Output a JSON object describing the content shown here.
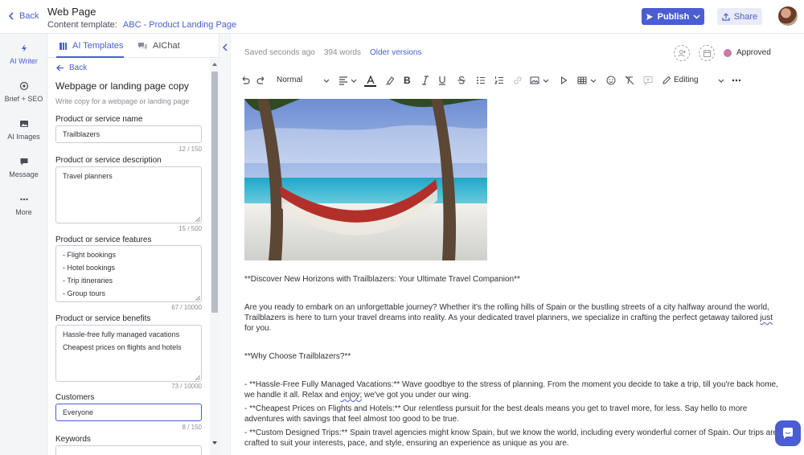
{
  "header": {
    "back_label": "Back",
    "title": "Web Page",
    "template_label": "Content template:",
    "template_link": "ABC - Product Landing Page",
    "publish_label": "Publish",
    "share_label": "Share"
  },
  "rail": {
    "items": [
      {
        "label": "AI Writer",
        "icon": "lightning-icon"
      },
      {
        "label": "Brief + SEO",
        "icon": "target-icon"
      },
      {
        "label": "AI Images",
        "icon": "image-icon"
      },
      {
        "label": "Message",
        "icon": "message-icon"
      },
      {
        "label": "More",
        "icon": "more-dots-icon"
      }
    ]
  },
  "panel": {
    "tabs": [
      {
        "label": "AI Templates",
        "icon": "templates-icon"
      },
      {
        "label": "AIChat",
        "icon": "chat-bubbles-icon"
      }
    ],
    "back_label": "Back",
    "section_title": "Webpage or landing page copy",
    "section_subtitle": "Write copy for a webpage or landing page",
    "fields": {
      "name": {
        "label": "Product or service name",
        "value": "Trailblazers",
        "counter": "12 / 150"
      },
      "description": {
        "label": "Product or service description",
        "value": "Travel planners",
        "counter": "15 / 500"
      },
      "features": {
        "label": "Product or service features",
        "lines": [
          "- Flight bookings",
          "- Hotel bookings",
          "- Trip itineraries",
          "- Group tours"
        ],
        "counter": "67 / 10000"
      },
      "benefits": {
        "label": "Product or service benefits",
        "lines": [
          "Hassle-free fully managed vacations",
          "Cheapest prices on flights and hotels"
        ],
        "counter": "73 / 10000"
      },
      "customers": {
        "label": "Customers",
        "value": "Everyone",
        "counter": "8 / 150"
      },
      "keywords": {
        "label": "Keywords"
      }
    }
  },
  "editor": {
    "saved": "Saved seconds ago",
    "words": "394 words",
    "versions": "Older versions",
    "status": "Approved",
    "toolbar": {
      "style": "Normal",
      "mode": "Editing"
    },
    "heading": "**Discover New Horizons with Trailblazers: Your Ultimate Travel Companion**",
    "intro_a": "Are you ready to embark on an unforgettable journey? Whether it's the rolling hills of Spain or the bustling streets of a city halfway around the world, Trailblazers is here to turn your travel dreams into reality. As your dedicated travel planners, we specialize in crafting the perfect getaway tailored ",
    "intro_flag": "just",
    "intro_b": " for you.",
    "why": "**Why Choose Trailblazers?**",
    "b1_a": "- **Hassle-Free Fully Managed Vacations:** Wave goodbye to the stress of planning. From the moment you decide to take a trip, till you're back home, we handle it all. Relax and ",
    "b1_flag": "enjoy;",
    "b1_b": " we've got you under our wing.",
    "b2": "- **Cheapest Prices on Flights and Hotels:** Our relentless pursuit for the best deals means you get to travel more, for less. Say hello to more adventures with savings that feel almost too good to be true.",
    "b3": "- **Custom Designed Trips:** Spain travel agencies might know Spain, but we know the world, including every wonderful corner of Spain. Our trips are crafted to suit your interests, pace, and style, ensuring an experience as unique as you are."
  },
  "colors": {
    "accent": "#4a5ed1",
    "status_dot": "#c97aa6"
  }
}
